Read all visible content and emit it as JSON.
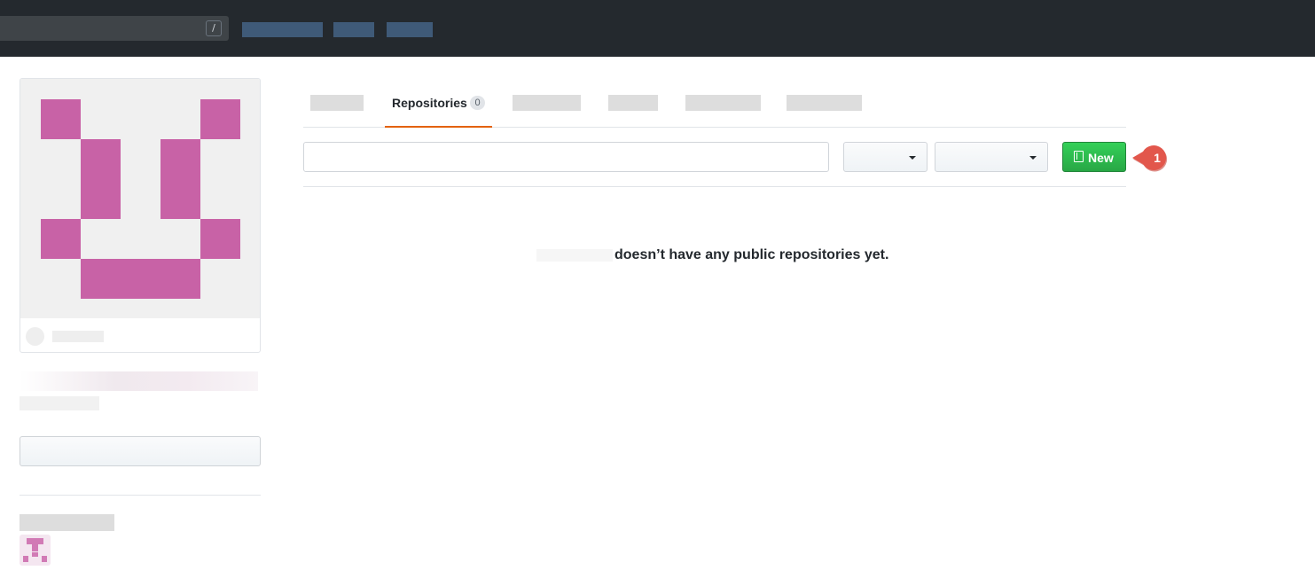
{
  "header": {
    "search_shortcut": "/"
  },
  "tabs": {
    "active": {
      "label": "Repositories",
      "count": "0"
    }
  },
  "toolbar": {
    "new_button_label": "New"
  },
  "annotation": {
    "badge": "1",
    "color": "#e2574c"
  },
  "empty_state": {
    "message": "doesn’t have any public repositories yet."
  },
  "colors": {
    "header_bg": "#24292e",
    "accent_tab": "#e36209",
    "new_button": "#28a745",
    "identicon": "#c862a6"
  }
}
